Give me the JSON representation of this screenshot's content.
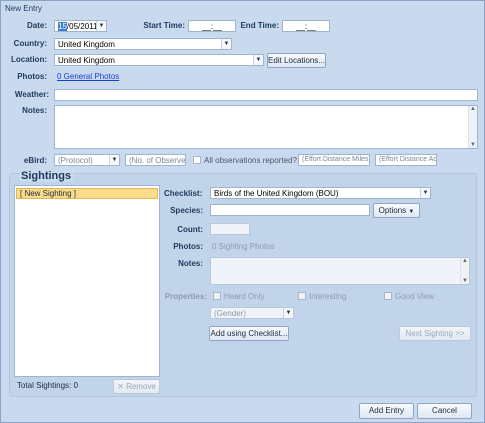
{
  "window": {
    "title": "New Entry"
  },
  "labels": {
    "date": "Date:",
    "start_time": "Start Time:",
    "end_time": "End Time:",
    "country": "Country:",
    "location": "Location:",
    "photos": "Photos:",
    "weather": "Weather:",
    "notes": "Notes:",
    "ebird": "eBird:"
  },
  "fields": {
    "date_selected": "15",
    "date_rest": "/05/2011",
    "start_time": "__:__",
    "end_time": "__:__",
    "country": "United Kingdom",
    "location": "United Kingdom",
    "weather": "",
    "notes": ""
  },
  "buttons": {
    "edit_locations": "Edit Locations...",
    "remove": "✕ Remove",
    "options": "Options",
    "add_using_checklist": "Add using Checklist...",
    "next_sighting": "Next Sighting >>",
    "add_entry": "Add Entry",
    "cancel": "Cancel"
  },
  "links": {
    "general_photos": "0 General Photos"
  },
  "ebird": {
    "protocol": "(Protocol)",
    "observers": "(No. of Observers)",
    "all_reported": "All observations reported?",
    "effort_distance": "(Effort Distance Miles)",
    "effort_area": "(Effort Distance Acres)"
  },
  "sightings": {
    "title": "Sightings",
    "items": [
      {
        "label": "[ New Sighting ]"
      }
    ],
    "total": "Total Sightings: 0",
    "labels": {
      "checklist": "Checklist:",
      "species": "Species:",
      "count": "Count:",
      "photos": "Photos:",
      "notes": "Notes:",
      "properties": "Properties:"
    },
    "checklist_value": "Birds of the United Kingdom (BOU)",
    "species_value": "",
    "count_value": "",
    "photos_value": "0 Sighting Photos",
    "notes_value": "",
    "properties": {
      "heard_only": "Heard Only",
      "interesting": "Interesting",
      "good_view": "Good View",
      "gender": "(Gender)"
    }
  },
  "icons": {
    "dropdown": "chevron-down-icon",
    "remove": "close-icon"
  }
}
